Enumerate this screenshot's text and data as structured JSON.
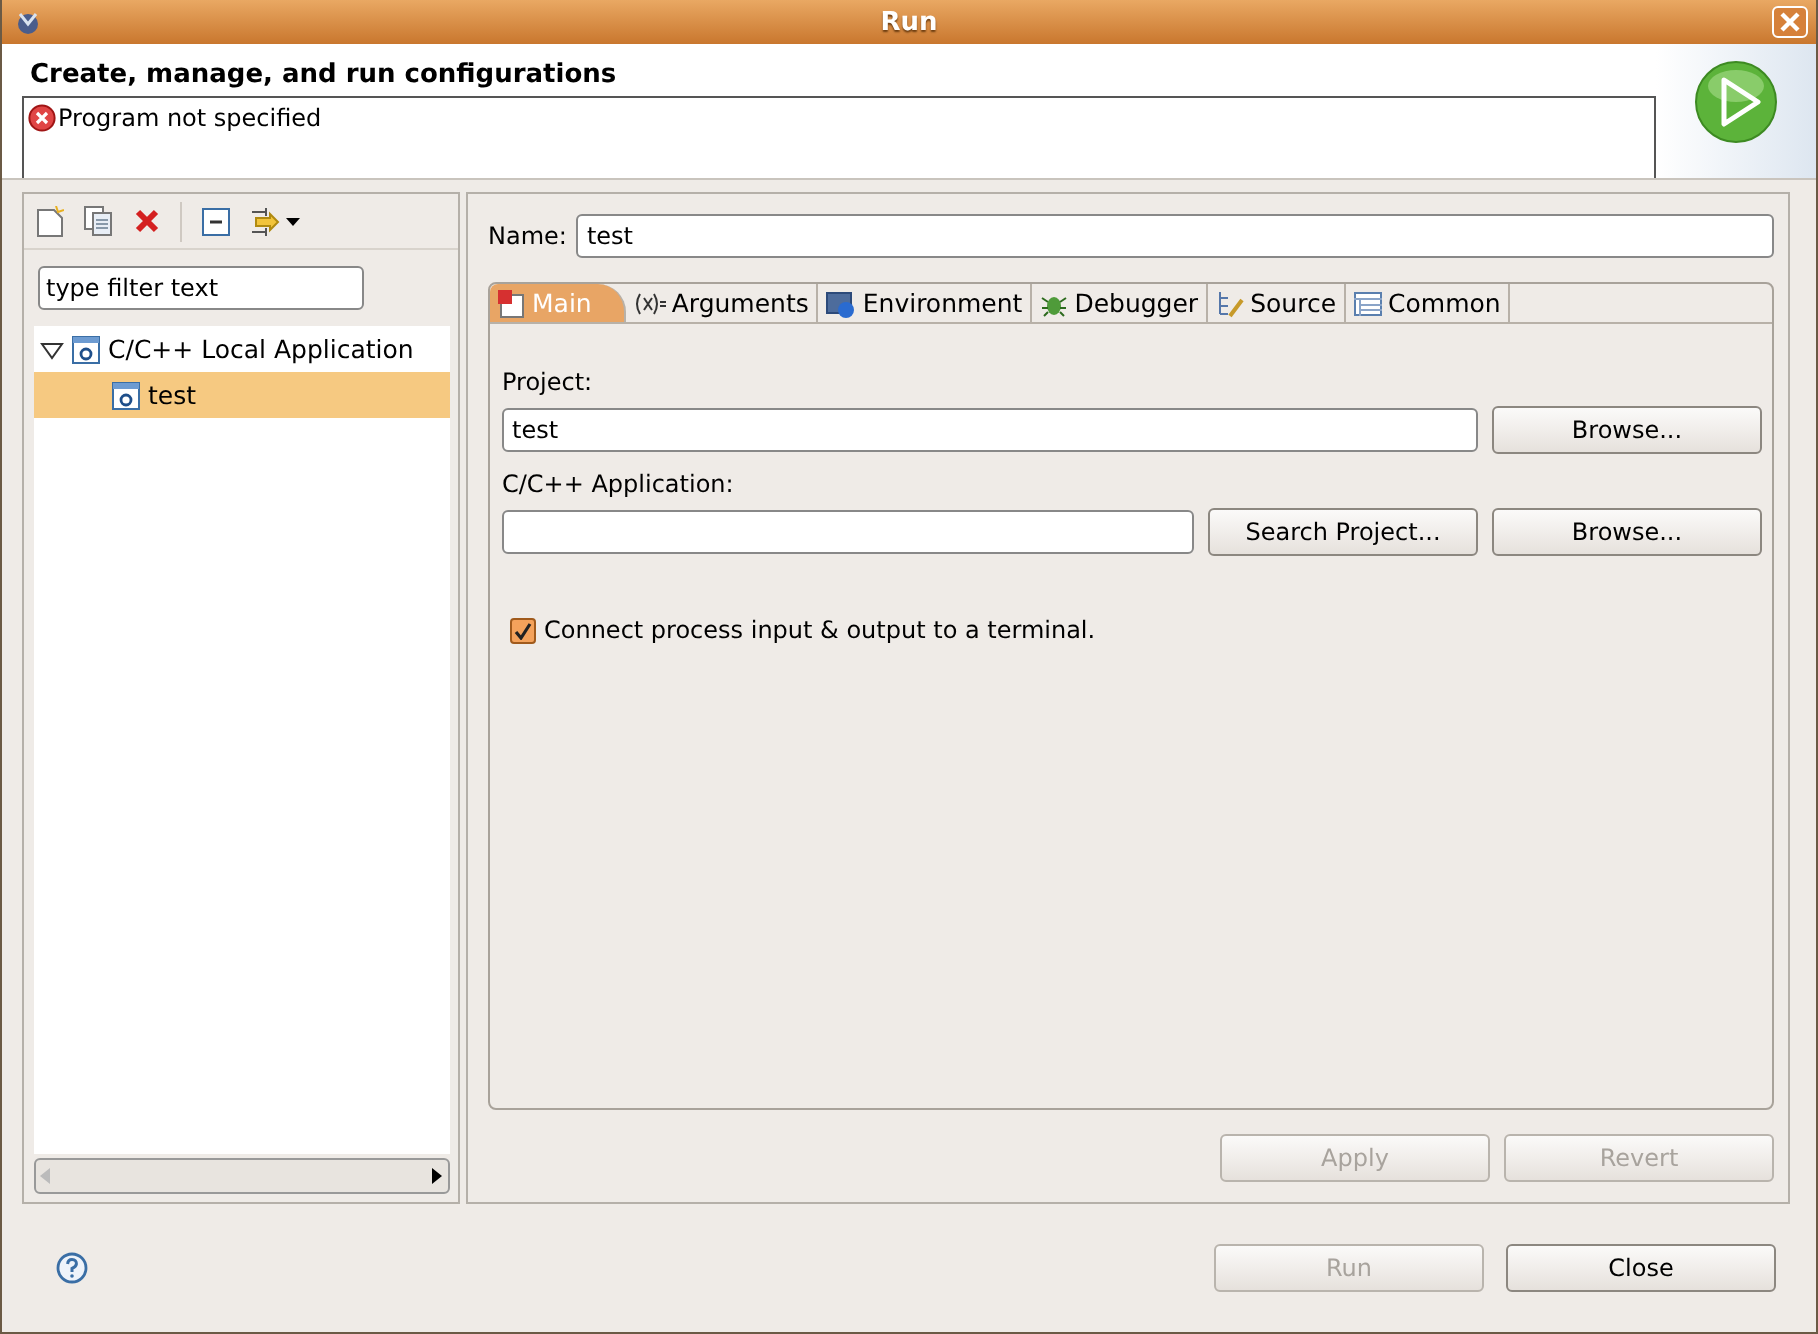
{
  "window": {
    "title": "Run"
  },
  "header": {
    "title": "Create, manage, and run configurations",
    "message": "Program not specified"
  },
  "filter": {
    "value": "type filter text"
  },
  "tree": [
    {
      "label": "C/C++ Local Application",
      "expanded": true,
      "selected": false,
      "children": [
        {
          "label": "test",
          "selected": true
        }
      ]
    }
  ],
  "name_field": {
    "label": "Name:",
    "value": "test"
  },
  "tabs": [
    {
      "label": "Main",
      "selected": true
    },
    {
      "label": "Arguments",
      "selected": false
    },
    {
      "label": "Environment",
      "selected": false
    },
    {
      "label": "Debugger",
      "selected": false
    },
    {
      "label": "Source",
      "selected": false
    },
    {
      "label": "Common",
      "selected": false
    }
  ],
  "project": {
    "label": "Project:",
    "value": "test",
    "buttons": [
      {
        "label": "Browse...",
        "disabled": false
      }
    ]
  },
  "application": {
    "label": "C/C++ Application:",
    "buttons": [
      {
        "label": "Search Project...",
        "disabled": false
      },
      {
        "label": "Browse...",
        "disabled": false
      }
    ]
  },
  "terminal": {
    "label": "Connect process input & output to a terminal.",
    "checked": true
  },
  "tab_buttons": [
    {
      "label": "Apply",
      "disabled": true
    },
    {
      "label": "Revert",
      "disabled": true
    }
  ],
  "dialog_buttons": [
    {
      "label": "Run",
      "disabled": true
    },
    {
      "label": "Close",
      "disabled": false
    }
  ]
}
